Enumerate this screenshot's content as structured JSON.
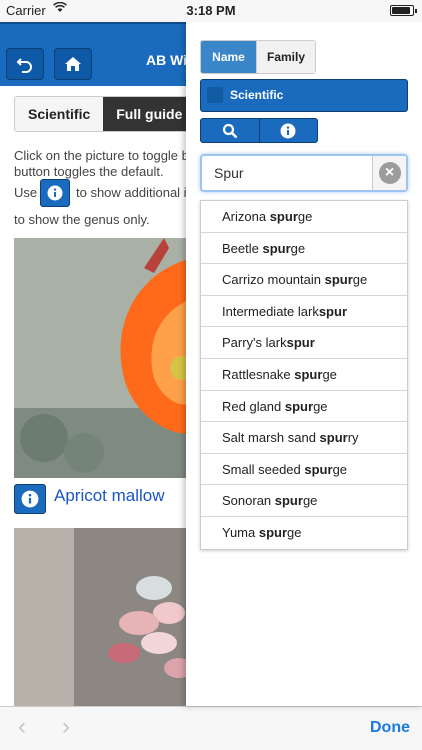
{
  "status_bar": {
    "carrier": "Carrier",
    "time": "3:18 PM",
    "battery_level": 0.92
  },
  "header": {
    "title": "AB Wil"
  },
  "guide_tabs": [
    {
      "label": "Scientific",
      "selected": false
    },
    {
      "label": "Full guide",
      "selected": true
    }
  ],
  "instructions": {
    "line1": "Click on the picture to toggle b",
    "line2": "button toggles the default.",
    "use_prefix": "Use",
    "use_suffix": "to show additional i",
    "line4": "to show the genus only."
  },
  "plant": {
    "name": "Apricot mallow"
  },
  "toolbar": {
    "back": "‹",
    "forward": "›",
    "done_label": "Done"
  },
  "search_panel": {
    "segment": [
      {
        "label": "Name",
        "selected": true
      },
      {
        "label": "Family",
        "selected": false
      }
    ],
    "scientific_label": "Scientific",
    "search_value": "Spur",
    "clear_icon": "×",
    "results": [
      {
        "before": "Arizona ",
        "match": "spur",
        "after": "ge"
      },
      {
        "before": "Beetle ",
        "match": "spur",
        "after": "ge"
      },
      {
        "before": "Carrizo mountain ",
        "match": "spur",
        "after": "ge"
      },
      {
        "before": "Intermediate lark",
        "match": "spur",
        "after": ""
      },
      {
        "before": "Parry's lark",
        "match": "spur",
        "after": ""
      },
      {
        "before": "Rattlesnake ",
        "match": "spur",
        "after": "ge"
      },
      {
        "before": "Red gland ",
        "match": "spur",
        "after": "ge"
      },
      {
        "before": "Salt marsh sand ",
        "match": "spur",
        "after": "ry"
      },
      {
        "before": "Small seeded ",
        "match": "spur",
        "after": "ge"
      },
      {
        "before": "Sonoran ",
        "match": "spur",
        "after": "ge"
      },
      {
        "before": "Yuma ",
        "match": "spur",
        "after": "ge"
      }
    ]
  },
  "colors": {
    "brand_blue": "#1a6bbd",
    "link_blue": "#1a55c8",
    "done_blue": "#1a7ae0"
  }
}
